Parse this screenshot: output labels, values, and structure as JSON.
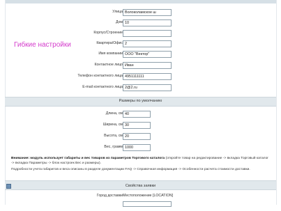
{
  "form": {
    "address_fields": [
      {
        "label": "Улица",
        "value": "Волоколамское ш"
      },
      {
        "label": "Дом",
        "value": "10"
      },
      {
        "label": "Корпус/Строение",
        "value": ""
      },
      {
        "label": "Квартира/Офис",
        "value": "2"
      },
      {
        "label": "Имя компании",
        "value": "ООО \"Вектор\""
      },
      {
        "label": "Контактное лицо",
        "value": "Иван"
      },
      {
        "label": "Телефон контактного лица",
        "value": "4951111111"
      },
      {
        "label": "E-mail контактного лица",
        "value": "2@2.ru"
      }
    ],
    "promo_text": "Гибкие настройки",
    "sizes_section_title": "Размеры по умолчанию",
    "size_fields": [
      {
        "label": "Длина, см",
        "value": "40"
      },
      {
        "label": "Ширина, см",
        "value": "30"
      },
      {
        "label": "Высота, см",
        "value": "20"
      },
      {
        "label": "Вес, грамм",
        "value": "1000"
      }
    ],
    "notice": {
      "bold": "Внимание: модуль использует габариты и вес товаров из параметров Торгового каталога",
      "rest": " (откройте товар на редактирование -> вкладка Торговый каталог -> вкладка Параметры -> блок настроек Вес и размеры).",
      "details": "Подробности учета габаритов и веса описаны в разделе документации FAQ -> Справочная информация -> Особенности расчета стоимости доставки."
    },
    "order_section_title": "Свойства заявки",
    "order_fields": [
      {
        "label": "Город доставки",
        "value": "Местоположение [LOCATION]"
      }
    ]
  }
}
